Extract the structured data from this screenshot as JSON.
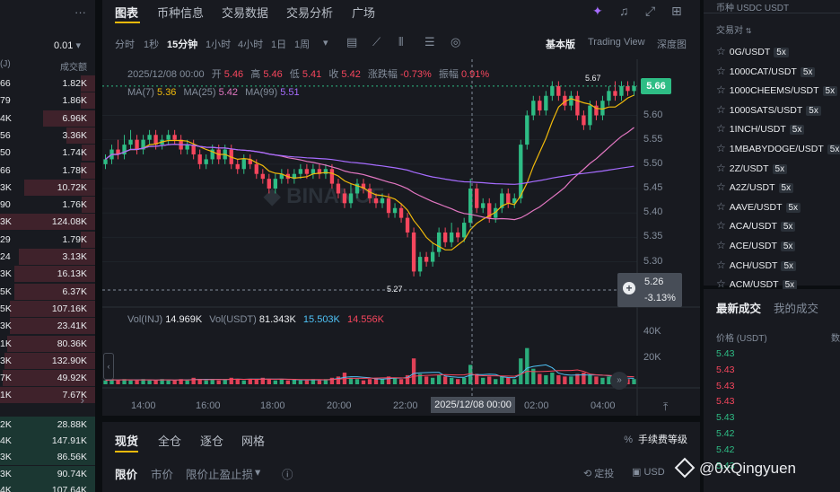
{
  "orderbook": {
    "precision": "0.01",
    "precision_suffix": "▾",
    "header_left": "(J)",
    "header_right": "成交额",
    "menu_icon": "more-dots-icon",
    "asks": [
      {
        "p": "66",
        "q": "1.82K",
        "d": 0.15
      },
      {
        "p": "79",
        "q": "1.86K",
        "d": 0.15
      },
      {
        "p": "4K",
        "q": "6.96K",
        "d": 0.55
      },
      {
        "p": "56",
        "q": "3.36K",
        "d": 0.3
      },
      {
        "p": "50",
        "q": "1.74K",
        "d": 0.14
      },
      {
        "p": "66",
        "q": "1.78K",
        "d": 0.15
      },
      {
        "p": "3K",
        "q": "10.72K",
        "d": 0.75
      },
      {
        "p": "90",
        "q": "1.76K",
        "d": 0.14
      },
      {
        "p": "3K",
        "q": "124.08K",
        "d": 1.0
      },
      {
        "p": "29",
        "q": "1.79K",
        "d": 0.15
      },
      {
        "p": "24",
        "q": "3.13K",
        "d": 0.8
      },
      {
        "p": "3K",
        "q": "16.13K",
        "d": 0.85
      },
      {
        "p": "5K",
        "q": "6.37K",
        "d": 0.85
      },
      {
        "p": "5K",
        "q": "107.16K",
        "d": 0.9
      },
      {
        "p": "3K",
        "q": "23.41K",
        "d": 0.9
      },
      {
        "p": "1K",
        "q": "80.36K",
        "d": 0.92
      },
      {
        "p": "3K",
        "q": "132.90K",
        "d": 0.95
      },
      {
        "p": "7K",
        "q": "49.92K",
        "d": 0.97
      },
      {
        "p": "1K",
        "q": "7.67K",
        "d": 1.0
      }
    ],
    "mid_arrow": "›",
    "bids": [
      {
        "p": "2K",
        "q": "28.88K",
        "d": 1.0
      },
      {
        "p": "4K",
        "q": "147.91K",
        "d": 1.0
      },
      {
        "p": "3K",
        "q": "86.56K",
        "d": 1.0
      },
      {
        "p": "3K",
        "q": "90.74K",
        "d": 1.0
      },
      {
        "p": "4K",
        "q": "107.64K",
        "d": 1.0
      }
    ]
  },
  "chart_panel": {
    "tabs": [
      "图表",
      "币种信息",
      "交易数据",
      "交易分析",
      "广场"
    ],
    "active_tab": 0,
    "top_icons": [
      "sparkle-icon",
      "bell-icon",
      "fullscreen-icon",
      "grid-icon"
    ],
    "intervals": [
      "分时",
      "1秒",
      "15分钟",
      "1小时",
      "4小时",
      "1日",
      "1周"
    ],
    "active_interval": 2,
    "interval_more": "▾",
    "tool_icons": [
      "indicator-icon",
      "line-chart-icon",
      "candle-type-icon",
      "settings-icon",
      "target-icon"
    ],
    "versions": [
      "基本版",
      "Trading View",
      "深度图"
    ],
    "active_version": 0,
    "ohlc": {
      "date": "2025/12/08 00:00",
      "open_label": "开",
      "open": "5.46",
      "high_label": "高",
      "high": "5.46",
      "low_label": "低",
      "low": "5.41",
      "close_label": "收",
      "close": "5.42",
      "chg_label": "涨跌幅",
      "chg": "-0.73%",
      "amp_label": "振幅",
      "amp": "0.91%"
    },
    "ma": {
      "ma7_label": "MA(7)",
      "ma7": "5.36",
      "ma25_label": "MA(25)",
      "ma25": "5.42",
      "ma99_label": "MA(99)",
      "ma99": "5.51"
    },
    "volume": {
      "vol_label": "Vol(INJ)",
      "vol": "14.969K",
      "volu_label": "Vol(USDT)",
      "volu": "81.343K",
      "v1": "15.503K",
      "v2": "14.556K"
    },
    "last_price": "5.66",
    "crosshair_price": "5.26",
    "crosshair_change": "-3.13%",
    "crosshair_time": "2025/12/08 00:00",
    "high_marker": "5.67",
    "low_marker": "5.27",
    "collapse_icon": "‹",
    "scroll_icon": "»",
    "expand_icon": "⤒",
    "colors": {
      "up": "#2ebd85",
      "down": "#f6465d",
      "ma7": "#f0b90b",
      "ma25": "#e377c2",
      "ma99": "#a66cff",
      "accent": "#f0b90b"
    }
  },
  "chart_data": {
    "type": "candlestick",
    "price_axis_ticks": [
      "5.60",
      "5.55",
      "5.50",
      "5.45",
      "5.40",
      "5.35",
      "5.30"
    ],
    "volume_axis_ticks": [
      "40K",
      "20K"
    ],
    "time_ticks": [
      "14:00",
      "16:00",
      "18:00",
      "20:00",
      "22:00",
      "02:00",
      "04:00"
    ],
    "ylim": [
      5.255,
      5.715
    ],
    "vol_max": 50,
    "candles": [
      [
        5.5,
        5.51,
        5.49,
        5.52
      ],
      [
        5.51,
        5.53,
        5.5,
        5.54
      ],
      [
        5.53,
        5.52,
        5.51,
        5.55
      ],
      [
        5.52,
        5.54,
        5.51,
        5.56
      ],
      [
        5.54,
        5.55,
        5.53,
        5.57
      ],
      [
        5.55,
        5.53,
        5.52,
        5.56
      ],
      [
        5.53,
        5.55,
        5.52,
        5.56
      ],
      [
        5.55,
        5.56,
        5.54,
        5.57
      ],
      [
        5.56,
        5.54,
        5.53,
        5.57
      ],
      [
        5.54,
        5.55,
        5.53,
        5.56
      ],
      [
        5.55,
        5.56,
        5.54,
        5.57
      ],
      [
        5.56,
        5.55,
        5.54,
        5.57
      ],
      [
        5.55,
        5.53,
        5.52,
        5.56
      ],
      [
        5.53,
        5.54,
        5.52,
        5.55
      ],
      [
        5.54,
        5.52,
        5.51,
        5.55
      ],
      [
        5.52,
        5.5,
        5.49,
        5.53
      ],
      [
        5.5,
        5.51,
        5.49,
        5.52
      ],
      [
        5.51,
        5.53,
        5.5,
        5.54
      ],
      [
        5.53,
        5.51,
        5.5,
        5.54
      ],
      [
        5.51,
        5.53,
        5.5,
        5.54
      ],
      [
        5.53,
        5.5,
        5.49,
        5.54
      ],
      [
        5.5,
        5.49,
        5.48,
        5.51
      ],
      [
        5.49,
        5.51,
        5.48,
        5.52
      ],
      [
        5.51,
        5.5,
        5.49,
        5.52
      ],
      [
        5.5,
        5.48,
        5.47,
        5.51
      ],
      [
        5.48,
        5.47,
        5.46,
        5.49
      ],
      [
        5.47,
        5.45,
        5.44,
        5.48
      ],
      [
        5.45,
        5.47,
        5.44,
        5.48
      ],
      [
        5.47,
        5.48,
        5.46,
        5.49
      ],
      [
        5.48,
        5.47,
        5.46,
        5.49
      ],
      [
        5.47,
        5.48,
        5.46,
        5.49
      ],
      [
        5.48,
        5.49,
        5.47,
        5.5
      ],
      [
        5.49,
        5.48,
        5.47,
        5.5
      ],
      [
        5.48,
        5.49,
        5.47,
        5.5
      ],
      [
        5.49,
        5.48,
        5.47,
        5.5
      ],
      [
        5.48,
        5.49,
        5.47,
        5.5
      ],
      [
        5.49,
        5.46,
        5.45,
        5.5
      ],
      [
        5.46,
        5.44,
        5.43,
        5.47
      ],
      [
        5.44,
        5.42,
        5.41,
        5.45
      ],
      [
        5.42,
        5.44,
        5.41,
        5.46
      ],
      [
        5.44,
        5.46,
        5.43,
        5.47
      ],
      [
        5.46,
        5.45,
        5.44,
        5.47
      ],
      [
        5.45,
        5.43,
        5.42,
        5.46
      ],
      [
        5.43,
        5.42,
        5.41,
        5.44
      ],
      [
        5.42,
        5.43,
        5.41,
        5.44
      ],
      [
        5.43,
        5.4,
        5.39,
        5.44
      ],
      [
        5.4,
        5.41,
        5.39,
        5.42
      ],
      [
        5.41,
        5.39,
        5.38,
        5.42
      ],
      [
        5.39,
        5.36,
        5.35,
        5.4
      ],
      [
        5.36,
        5.28,
        5.27,
        5.37
      ],
      [
        5.28,
        5.31,
        5.27,
        5.32
      ],
      [
        5.31,
        5.3,
        5.29,
        5.32
      ],
      [
        5.3,
        5.32,
        5.29,
        5.34
      ],
      [
        5.32,
        5.36,
        5.31,
        5.37
      ],
      [
        5.36,
        5.34,
        5.33,
        5.37
      ],
      [
        5.34,
        5.36,
        5.33,
        5.38
      ],
      [
        5.36,
        5.35,
        5.34,
        5.37
      ],
      [
        5.35,
        5.38,
        5.34,
        5.39
      ],
      [
        5.38,
        5.45,
        5.37,
        5.47
      ],
      [
        5.45,
        5.41,
        5.4,
        5.46
      ],
      [
        5.41,
        5.42,
        5.4,
        5.43
      ],
      [
        5.42,
        5.39,
        5.38,
        5.43
      ],
      [
        5.39,
        5.41,
        5.38,
        5.42
      ],
      [
        5.41,
        5.44,
        5.4,
        5.45
      ],
      [
        5.44,
        5.42,
        5.41,
        5.45
      ],
      [
        5.42,
        5.43,
        5.41,
        5.44
      ],
      [
        5.43,
        5.54,
        5.42,
        5.55
      ],
      [
        5.54,
        5.6,
        5.53,
        5.61
      ],
      [
        5.6,
        5.63,
        5.59,
        5.64
      ],
      [
        5.63,
        5.61,
        5.6,
        5.64
      ],
      [
        5.61,
        5.64,
        5.6,
        5.65
      ],
      [
        5.64,
        5.66,
        5.63,
        5.67
      ],
      [
        5.66,
        5.64,
        5.63,
        5.67
      ],
      [
        5.64,
        5.62,
        5.61,
        5.65
      ],
      [
        5.62,
        5.64,
        5.61,
        5.65
      ],
      [
        5.64,
        5.6,
        5.59,
        5.65
      ],
      [
        5.6,
        5.58,
        5.57,
        5.61
      ],
      [
        5.58,
        5.62,
        5.57,
        5.63
      ],
      [
        5.62,
        5.6,
        5.59,
        5.63
      ],
      [
        5.6,
        5.63,
        5.59,
        5.64
      ],
      [
        5.63,
        5.65,
        5.62,
        5.66
      ],
      [
        5.65,
        5.64,
        5.63,
        5.67
      ],
      [
        5.64,
        5.66,
        5.63,
        5.67
      ],
      [
        5.66,
        5.65,
        5.64,
        5.67
      ],
      [
        5.65,
        5.66,
        5.64,
        5.67
      ]
    ],
    "volumes": [
      3,
      4,
      3,
      4,
      3,
      3,
      4,
      3,
      3,
      4,
      3,
      3,
      4,
      3,
      5,
      4,
      3,
      4,
      3,
      4,
      5,
      4,
      3,
      4,
      4,
      5,
      4,
      3,
      4,
      3,
      4,
      3,
      3,
      4,
      3,
      4,
      5,
      6,
      9,
      5,
      4,
      3,
      4,
      5,
      4,
      6,
      5,
      4,
      7,
      20,
      8,
      6,
      5,
      7,
      6,
      5,
      4,
      5,
      15,
      8,
      5,
      6,
      4,
      6,
      5,
      4,
      20,
      28,
      12,
      8,
      7,
      9,
      7,
      6,
      6,
      8,
      9,
      7,
      6,
      5,
      6,
      5,
      4,
      4,
      4
    ]
  },
  "trade_panel": {
    "tabs": [
      "现货",
      "全仓",
      "逐仓",
      "网格"
    ],
    "active_tab": 0,
    "fee_label": "手续费等级",
    "fee_icon": "%",
    "order_types": [
      "限价",
      "市价",
      "限价止盈止损"
    ],
    "active_order_type": 0,
    "order_type_more": "▾",
    "info_icon": "ⓘ",
    "right_items": [
      "定投",
      "USD"
    ]
  },
  "symbol_list": {
    "top_text": "币种   USDC   USDT",
    "header": "交易对",
    "symbols": [
      {
        "name": "0G/USDT",
        "lev": "5x"
      },
      {
        "name": "1000CAT/USDT",
        "lev": "5x"
      },
      {
        "name": "1000CHEEMS/USDT",
        "lev": "5x"
      },
      {
        "name": "1000SATS/USDT",
        "lev": "5x"
      },
      {
        "name": "1INCH/USDT",
        "lev": "5x"
      },
      {
        "name": "1MBABYDOGE/USDT",
        "lev": "5x"
      },
      {
        "name": "2Z/USDT",
        "lev": "5x"
      },
      {
        "name": "A2Z/USDT",
        "lev": "5x"
      },
      {
        "name": "AAVE/USDT",
        "lev": "5x"
      },
      {
        "name": "ACA/USDT",
        "lev": "5x"
      },
      {
        "name": "ACE/USDT",
        "lev": "5x"
      },
      {
        "name": "ACH/USDT",
        "lev": "5x"
      },
      {
        "name": "ACM/USDT",
        "lev": "5x"
      }
    ]
  },
  "trades": {
    "tabs": [
      "最新成交",
      "我的成交"
    ],
    "active_tab": 0,
    "header": "价格 (USDT)",
    "header2": "数",
    "rows": [
      {
        "p": "5.43",
        "side": "up"
      },
      {
        "p": "5.43",
        "side": "down"
      },
      {
        "p": "5.43",
        "side": "down"
      },
      {
        "p": "5.43",
        "side": "down"
      },
      {
        "p": "5.43",
        "side": "up"
      },
      {
        "p": "5.42",
        "side": "up"
      },
      {
        "p": "5.42",
        "side": "up"
      },
      {
        "p": "5.43",
        "side": "up"
      }
    ]
  },
  "watermark": "@0xQingyuen"
}
